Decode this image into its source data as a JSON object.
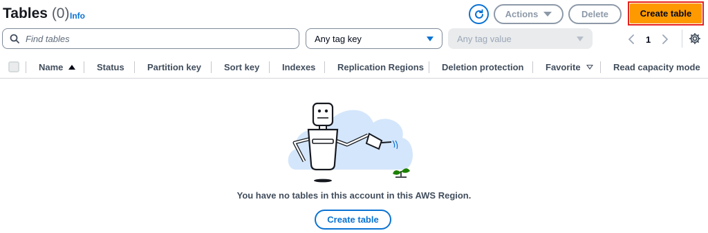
{
  "header": {
    "title": "Tables",
    "count": "(0)",
    "info": "Info",
    "actions_label": "Actions",
    "delete_label": "Delete",
    "create_label": "Create table"
  },
  "filters": {
    "search_placeholder": "Find tables",
    "tag_key_label": "Any tag key",
    "tag_value_label": "Any tag value"
  },
  "pagination": {
    "current_page": "1"
  },
  "table": {
    "columns": [
      "Name",
      "Status",
      "Partition key",
      "Sort key",
      "Indexes",
      "Replication Regions",
      "Deletion protection",
      "Favorite",
      "Read capacity mode"
    ]
  },
  "empty_state": {
    "message": "You have no tables in this account in this AWS Region.",
    "create_label": "Create table"
  },
  "colors": {
    "primary_button": "#ff9900",
    "link": "#0972d3",
    "highlight_border": "#e8201a"
  },
  "icons": [
    "refresh-icon",
    "search-icon",
    "chevron-left-icon",
    "chevron-right-icon",
    "settings-icon",
    "sort-ascending-icon",
    "filter-icon",
    "robot-watering-can-illustration"
  ]
}
